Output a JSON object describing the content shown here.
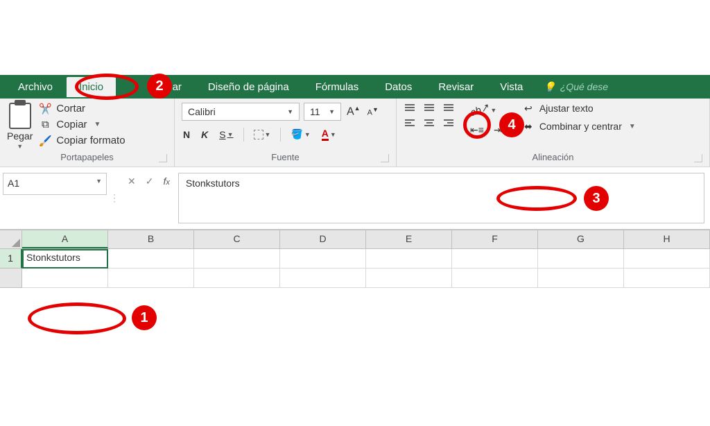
{
  "tabs": {
    "archivo": "Archivo",
    "inicio": "Inicio",
    "insertar": "ar",
    "diseno": "Diseño de página",
    "formulas": "Fórmulas",
    "datos": "Datos",
    "revisar": "Revisar",
    "vista": "Vista",
    "tellme": "¿Qué dese"
  },
  "clipboard": {
    "pegar": "Pegar",
    "cortar": "Cortar",
    "copiar": "Copiar",
    "formato": "Copiar formato",
    "label": "Portapapeles"
  },
  "font": {
    "name": "Calibri",
    "size": "11",
    "bold": "N",
    "italic": "K",
    "underline": "S",
    "label": "Fuente"
  },
  "alignment": {
    "wrap": "Ajustar texto",
    "merge": "Combinar y centrar",
    "label": "Alineación"
  },
  "namebox": "A1",
  "formula_value": "Stonkstutors",
  "columns": [
    "A",
    "B",
    "C",
    "D",
    "E",
    "F",
    "G",
    "H"
  ],
  "row1": "1",
  "cell_a1": "Stonkstutors",
  "annotations": {
    "n1": "1",
    "n2": "2",
    "n3": "3",
    "n4": "4"
  }
}
